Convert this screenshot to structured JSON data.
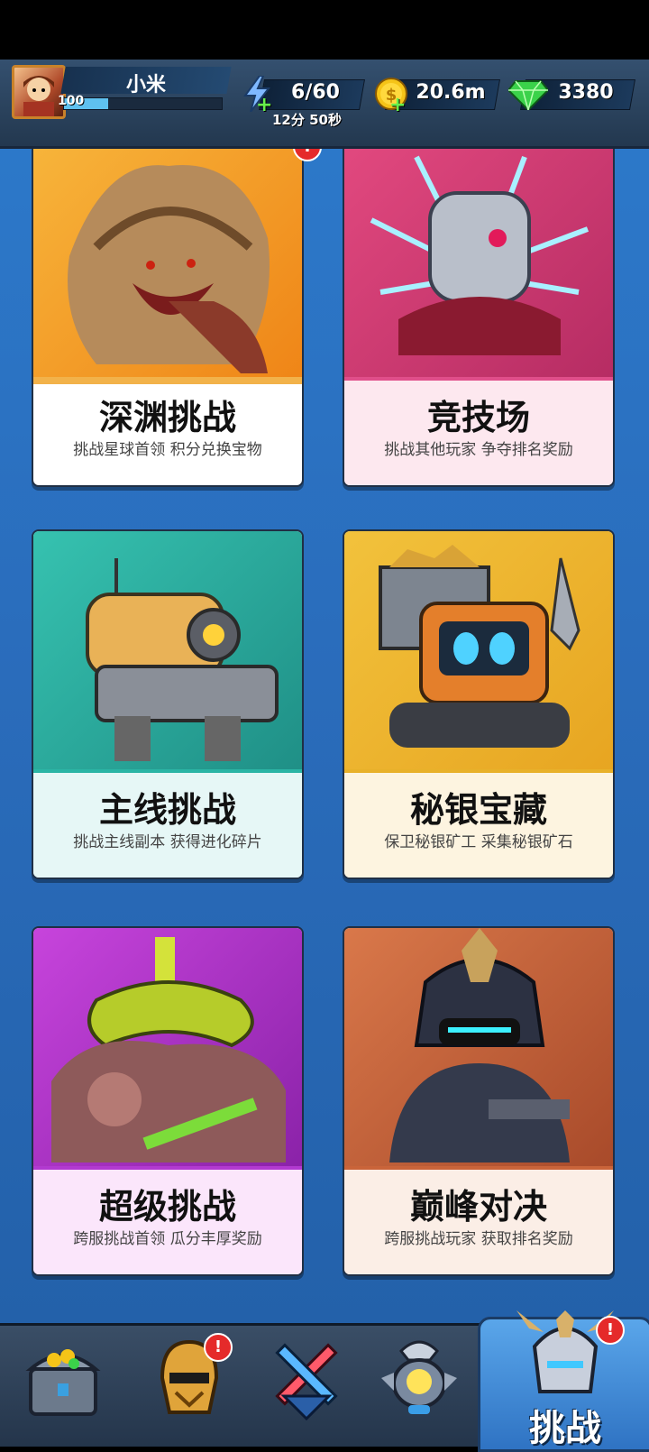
{
  "player": {
    "name": "小米",
    "level": "100",
    "xp_progress": 0.28
  },
  "resources": {
    "energy": {
      "value": "6/60",
      "timer": "12分 50秒",
      "icon": "lightning-icon"
    },
    "gold": {
      "value": "20.6m",
      "icon": "gold-coin-icon"
    },
    "gems": {
      "value": "3380",
      "icon": "green-gem-icon"
    }
  },
  "modes": [
    {
      "title": "深渊挑战",
      "subtitle": "挑战星球首领 积分兑换宝物",
      "icon": "abyss-monster"
    },
    {
      "title": "竞技场",
      "subtitle": "挑战其他玩家 争夺排名奖励",
      "icon": "arena-robot"
    },
    {
      "title": "主线挑战",
      "subtitle": "挑战主线副本 获得进化碎片",
      "icon": "mech-robot"
    },
    {
      "title": "秘银宝藏",
      "subtitle": "保卫秘银矿工 采集秘银矿石",
      "icon": "mining-robot"
    },
    {
      "title": "超级挑战",
      "subtitle": "跨服挑战首领 瓜分丰厚奖励",
      "icon": "super-boss"
    },
    {
      "title": "巅峰对决",
      "subtitle": "跨服挑战玩家 获取排名奖励",
      "icon": "peak-warrior"
    }
  ],
  "bottom_nav": {
    "items": [
      {
        "icon": "treasure-chest-icon",
        "badge": ""
      },
      {
        "icon": "hero-helmet-icon",
        "badge": "!"
      },
      {
        "icon": "crossed-swords-icon",
        "badge": ""
      },
      {
        "icon": "drone-icon",
        "badge": ""
      }
    ],
    "active": {
      "label": "挑战",
      "icon": "challenge-helmet-icon",
      "badge": "!"
    }
  },
  "colors": {
    "accent_blue": "#2c78c9",
    "card_orange": "#f39a1c",
    "card_pink": "#d8437a",
    "card_teal": "#2bb5a5",
    "card_yellow": "#e8b12a",
    "card_purple": "#b23ad0",
    "card_rust": "#c9643a"
  }
}
